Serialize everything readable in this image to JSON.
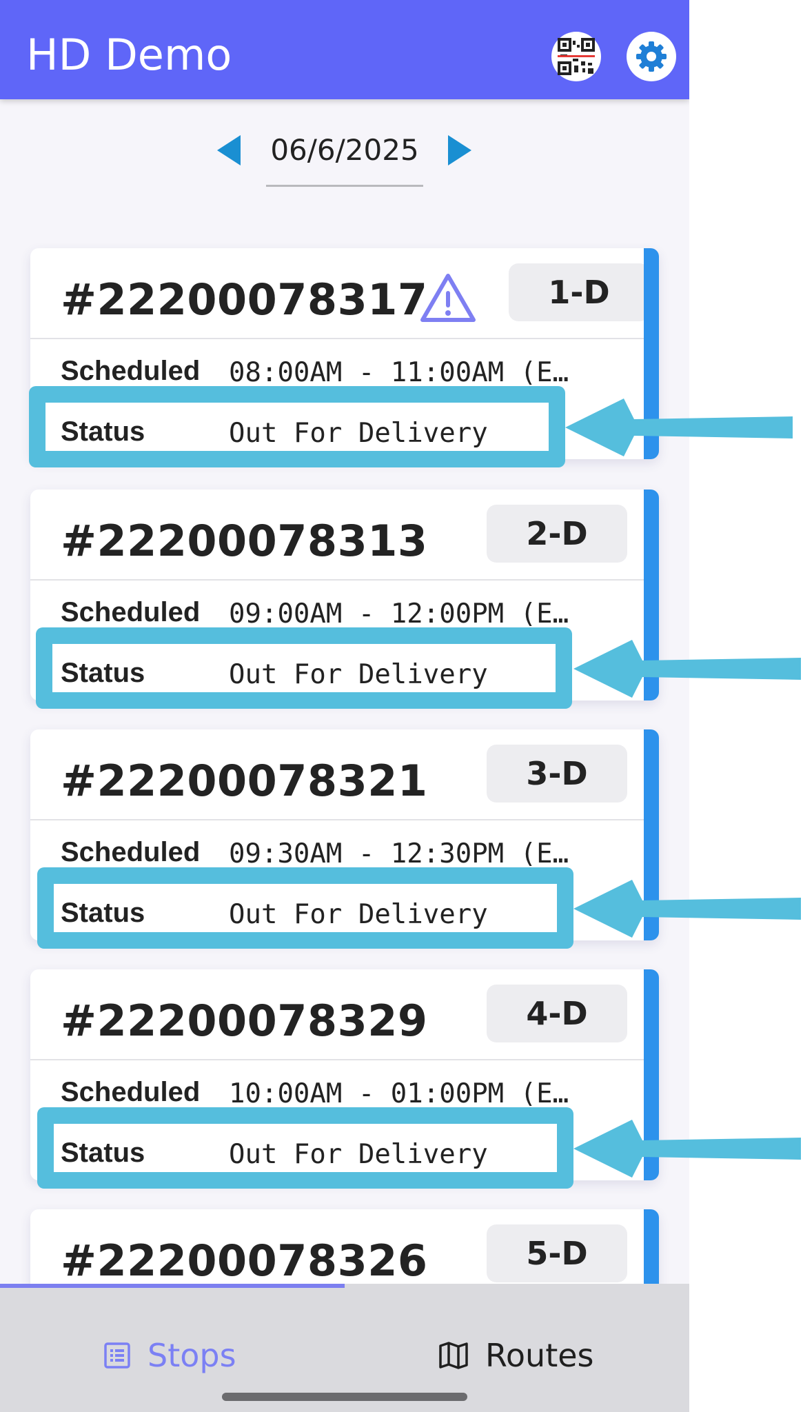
{
  "header": {
    "title": "HD Demo",
    "qr_icon": "qr-code-icon",
    "settings_icon": "gear-icon",
    "bar_color": "#5f66f8"
  },
  "date_picker": {
    "date": "06/6/2025",
    "prev_icon": "triangle-left-icon",
    "next_icon": "triangle-right-icon",
    "arrow_color": "#1a8fd2"
  },
  "stops": [
    {
      "order": "#22200078317",
      "badge": "1-D",
      "warning": true,
      "scheduled_label": "Scheduled",
      "scheduled": "08:00AM - 11:00AM (E…",
      "status_label": "Status",
      "status": "Out For Delivery"
    },
    {
      "order": "#22200078313",
      "badge": "2-D",
      "warning": false,
      "scheduled_label": "Scheduled",
      "scheduled": "09:00AM - 12:00PM (E…",
      "status_label": "Status",
      "status": "Out For Delivery"
    },
    {
      "order": "#22200078321",
      "badge": "3-D",
      "warning": false,
      "scheduled_label": "Scheduled",
      "scheduled": "09:30AM - 12:30PM (E…",
      "status_label": "Status",
      "status": "Out For Delivery"
    },
    {
      "order": "#22200078329",
      "badge": "4-D",
      "warning": false,
      "scheduled_label": "Scheduled",
      "scheduled": "10:00AM - 01:00PM (E…",
      "status_label": "Status",
      "status": "Out For Delivery"
    },
    {
      "order": "#22200078326",
      "badge": "5-D",
      "warning": false
    }
  ],
  "annotation": {
    "highlight_color": "#55bedd"
  },
  "bottom_nav": {
    "tabs": [
      {
        "label": "Stops",
        "icon": "list-icon",
        "active": true
      },
      {
        "label": "Routes",
        "icon": "map-icon",
        "active": false
      }
    ],
    "active_color": "#7b80f4"
  }
}
